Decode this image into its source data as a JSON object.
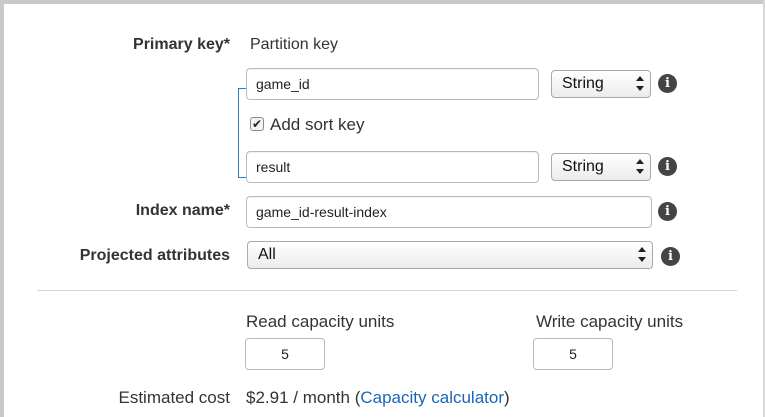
{
  "primary_key": {
    "label": "Primary key*",
    "partition_key_label": "Partition key",
    "partition_key_value": "game_id",
    "partition_key_type": "String",
    "add_sort_key_label": "Add sort key",
    "add_sort_key_checked": true,
    "checkbox_mark": "✔",
    "sort_key_value": "result",
    "sort_key_type": "String"
  },
  "index_name": {
    "label": "Index name*",
    "value": "game_id-result-index"
  },
  "projected_attributes": {
    "label": "Projected attributes",
    "selected": "All"
  },
  "capacity": {
    "read_label": "Read capacity units",
    "read_value": "5",
    "write_label": "Write capacity units",
    "write_value": "5"
  },
  "estimated_cost": {
    "label": "Estimated cost",
    "value": "$2.91 / month",
    "open_paren": "(",
    "link_text": "Capacity calculator",
    "close_paren": ")"
  },
  "info_icon_glyph": "i",
  "colors": {
    "link": "#1a66b5",
    "bracket": "#2a7bbf",
    "info_icon": "#444444"
  }
}
